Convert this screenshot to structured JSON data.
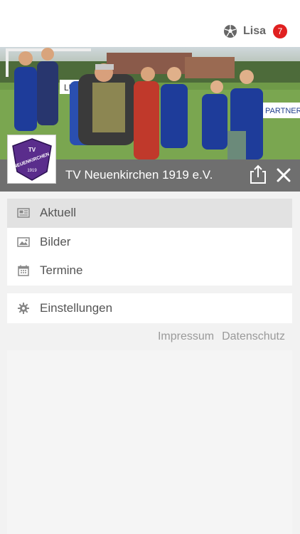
{
  "header": {
    "user_name": "Lisa",
    "notification_count": "7",
    "icon": "football-icon"
  },
  "hero": {
    "description_icon": "team-photo",
    "banner_text": "LUE",
    "banner_text_right": "PARTNER"
  },
  "club": {
    "name": "TV Neuenkirchen 1919 e.V.",
    "logo_text_top": "TV",
    "logo_text_main": "NEUENKIRCHEN",
    "logo_text_year": "1919"
  },
  "menu": {
    "items": [
      {
        "label": "Aktuell",
        "icon": "newspaper-icon",
        "active": true
      },
      {
        "label": "Bilder",
        "icon": "image-icon",
        "active": false
      },
      {
        "label": "Termine",
        "icon": "calendar-icon",
        "active": false
      }
    ],
    "settings": {
      "label": "Einstellungen",
      "icon": "gear-icon"
    }
  },
  "footer": {
    "impressum": "Impressum",
    "datenschutz": "Datenschutz"
  },
  "colors": {
    "badge": "#e02020",
    "club_bar": "#646464",
    "logo_purple": "#5a2d8c"
  }
}
